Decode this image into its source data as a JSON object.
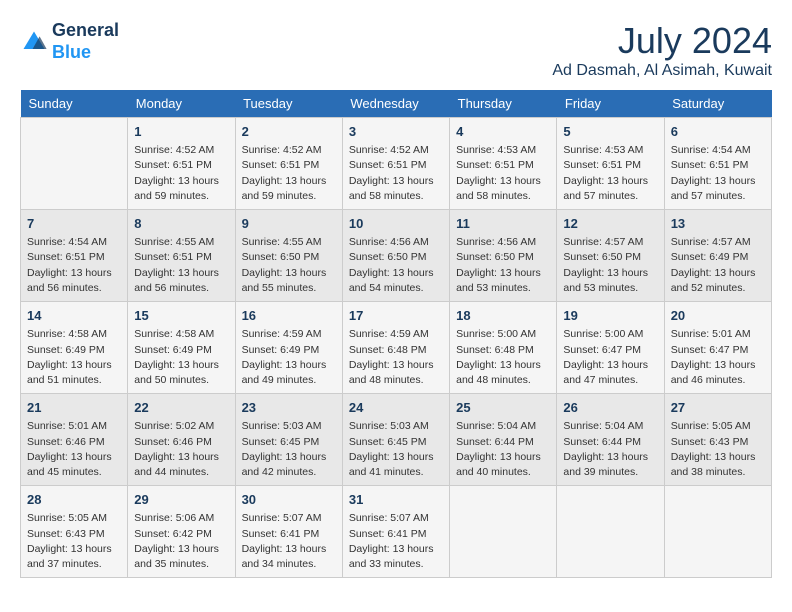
{
  "header": {
    "logo_line1": "General",
    "logo_line2": "Blue",
    "month_title": "July 2024",
    "location": "Ad Dasmah, Al Asimah, Kuwait"
  },
  "weekdays": [
    "Sunday",
    "Monday",
    "Tuesday",
    "Wednesday",
    "Thursday",
    "Friday",
    "Saturday"
  ],
  "weeks": [
    [
      {
        "day": "",
        "info": ""
      },
      {
        "day": "1",
        "info": "Sunrise: 4:52 AM\nSunset: 6:51 PM\nDaylight: 13 hours\nand 59 minutes."
      },
      {
        "day": "2",
        "info": "Sunrise: 4:52 AM\nSunset: 6:51 PM\nDaylight: 13 hours\nand 59 minutes."
      },
      {
        "day": "3",
        "info": "Sunrise: 4:52 AM\nSunset: 6:51 PM\nDaylight: 13 hours\nand 58 minutes."
      },
      {
        "day": "4",
        "info": "Sunrise: 4:53 AM\nSunset: 6:51 PM\nDaylight: 13 hours\nand 58 minutes."
      },
      {
        "day": "5",
        "info": "Sunrise: 4:53 AM\nSunset: 6:51 PM\nDaylight: 13 hours\nand 57 minutes."
      },
      {
        "day": "6",
        "info": "Sunrise: 4:54 AM\nSunset: 6:51 PM\nDaylight: 13 hours\nand 57 minutes."
      }
    ],
    [
      {
        "day": "7",
        "info": "Sunrise: 4:54 AM\nSunset: 6:51 PM\nDaylight: 13 hours\nand 56 minutes."
      },
      {
        "day": "8",
        "info": "Sunrise: 4:55 AM\nSunset: 6:51 PM\nDaylight: 13 hours\nand 56 minutes."
      },
      {
        "day": "9",
        "info": "Sunrise: 4:55 AM\nSunset: 6:50 PM\nDaylight: 13 hours\nand 55 minutes."
      },
      {
        "day": "10",
        "info": "Sunrise: 4:56 AM\nSunset: 6:50 PM\nDaylight: 13 hours\nand 54 minutes."
      },
      {
        "day": "11",
        "info": "Sunrise: 4:56 AM\nSunset: 6:50 PM\nDaylight: 13 hours\nand 53 minutes."
      },
      {
        "day": "12",
        "info": "Sunrise: 4:57 AM\nSunset: 6:50 PM\nDaylight: 13 hours\nand 53 minutes."
      },
      {
        "day": "13",
        "info": "Sunrise: 4:57 AM\nSunset: 6:49 PM\nDaylight: 13 hours\nand 52 minutes."
      }
    ],
    [
      {
        "day": "14",
        "info": "Sunrise: 4:58 AM\nSunset: 6:49 PM\nDaylight: 13 hours\nand 51 minutes."
      },
      {
        "day": "15",
        "info": "Sunrise: 4:58 AM\nSunset: 6:49 PM\nDaylight: 13 hours\nand 50 minutes."
      },
      {
        "day": "16",
        "info": "Sunrise: 4:59 AM\nSunset: 6:49 PM\nDaylight: 13 hours\nand 49 minutes."
      },
      {
        "day": "17",
        "info": "Sunrise: 4:59 AM\nSunset: 6:48 PM\nDaylight: 13 hours\nand 48 minutes."
      },
      {
        "day": "18",
        "info": "Sunrise: 5:00 AM\nSunset: 6:48 PM\nDaylight: 13 hours\nand 48 minutes."
      },
      {
        "day": "19",
        "info": "Sunrise: 5:00 AM\nSunset: 6:47 PM\nDaylight: 13 hours\nand 47 minutes."
      },
      {
        "day": "20",
        "info": "Sunrise: 5:01 AM\nSunset: 6:47 PM\nDaylight: 13 hours\nand 46 minutes."
      }
    ],
    [
      {
        "day": "21",
        "info": "Sunrise: 5:01 AM\nSunset: 6:46 PM\nDaylight: 13 hours\nand 45 minutes."
      },
      {
        "day": "22",
        "info": "Sunrise: 5:02 AM\nSunset: 6:46 PM\nDaylight: 13 hours\nand 44 minutes."
      },
      {
        "day": "23",
        "info": "Sunrise: 5:03 AM\nSunset: 6:45 PM\nDaylight: 13 hours\nand 42 minutes."
      },
      {
        "day": "24",
        "info": "Sunrise: 5:03 AM\nSunset: 6:45 PM\nDaylight: 13 hours\nand 41 minutes."
      },
      {
        "day": "25",
        "info": "Sunrise: 5:04 AM\nSunset: 6:44 PM\nDaylight: 13 hours\nand 40 minutes."
      },
      {
        "day": "26",
        "info": "Sunrise: 5:04 AM\nSunset: 6:44 PM\nDaylight: 13 hours\nand 39 minutes."
      },
      {
        "day": "27",
        "info": "Sunrise: 5:05 AM\nSunset: 6:43 PM\nDaylight: 13 hours\nand 38 minutes."
      }
    ],
    [
      {
        "day": "28",
        "info": "Sunrise: 5:05 AM\nSunset: 6:43 PM\nDaylight: 13 hours\nand 37 minutes."
      },
      {
        "day": "29",
        "info": "Sunrise: 5:06 AM\nSunset: 6:42 PM\nDaylight: 13 hours\nand 35 minutes."
      },
      {
        "day": "30",
        "info": "Sunrise: 5:07 AM\nSunset: 6:41 PM\nDaylight: 13 hours\nand 34 minutes."
      },
      {
        "day": "31",
        "info": "Sunrise: 5:07 AM\nSunset: 6:41 PM\nDaylight: 13 hours\nand 33 minutes."
      },
      {
        "day": "",
        "info": ""
      },
      {
        "day": "",
        "info": ""
      },
      {
        "day": "",
        "info": ""
      }
    ]
  ]
}
